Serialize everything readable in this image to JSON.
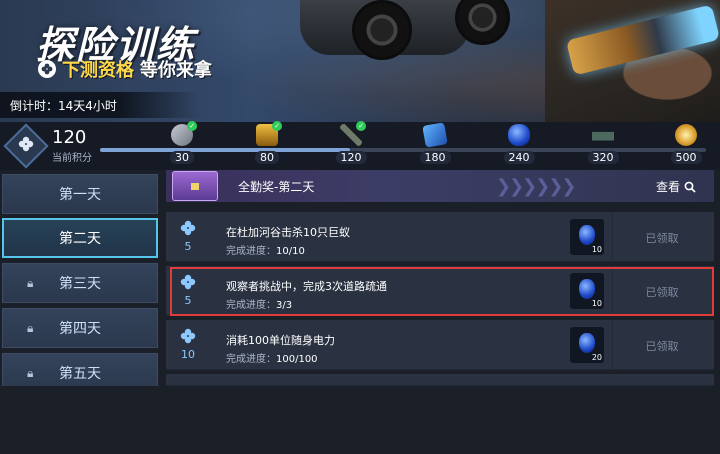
{
  "banner": {
    "title": "探险训练",
    "subtitle_highlight": "下测资格",
    "subtitle_rest": "等你来拿",
    "countdown": "倒计时：14天4小时"
  },
  "points": {
    "value": "120",
    "label": "当前积分"
  },
  "progress": {
    "current": 120,
    "max": 500,
    "milestones": [
      {
        "value": "30",
        "icon": "gear-icon",
        "claimed": true
      },
      {
        "value": "80",
        "icon": "treasure-box-icon",
        "claimed": true
      },
      {
        "value": "120",
        "icon": "weapon-icon",
        "claimed": true
      },
      {
        "value": "180",
        "icon": "card-icon",
        "claimed": false
      },
      {
        "value": "240",
        "icon": "blue-gem-icon",
        "claimed": false
      },
      {
        "value": "320",
        "icon": "vehicle-icon",
        "claimed": false
      },
      {
        "value": "500",
        "icon": "gold-medal-icon",
        "claimed": false
      }
    ]
  },
  "sidebar": {
    "days": [
      {
        "label": "第一天",
        "locked": false,
        "active": false
      },
      {
        "label": "第二天",
        "locked": false,
        "active": true
      },
      {
        "label": "第三天",
        "locked": true,
        "active": false
      },
      {
        "label": "第四天",
        "locked": true,
        "active": false
      },
      {
        "label": "第五天",
        "locked": true,
        "active": false
      }
    ]
  },
  "header": {
    "title": "全勤奖-第二天",
    "view_label": "查看"
  },
  "tasks": [
    {
      "points": "5",
      "title": "在杜加河谷击杀10只巨蚁",
      "progress_label": "完成进度：",
      "progress_value": "10/10",
      "reward_qty": "10",
      "status": "已领取"
    },
    {
      "points": "5",
      "title": "观察者挑战中，完成3次道路疏通",
      "progress_label": "完成进度：",
      "progress_value": "3/3",
      "reward_qty": "10",
      "status": "已领取"
    },
    {
      "points": "10",
      "title": "消耗100单位随身电力",
      "progress_label": "完成进度：",
      "progress_value": "100/100",
      "reward_qty": "20",
      "status": "已领取"
    }
  ],
  "colors": {
    "accent": "#55c6ea",
    "highlight": "#e23b3b",
    "clover": "#8dc9ff",
    "gold": "#ffd94a"
  }
}
